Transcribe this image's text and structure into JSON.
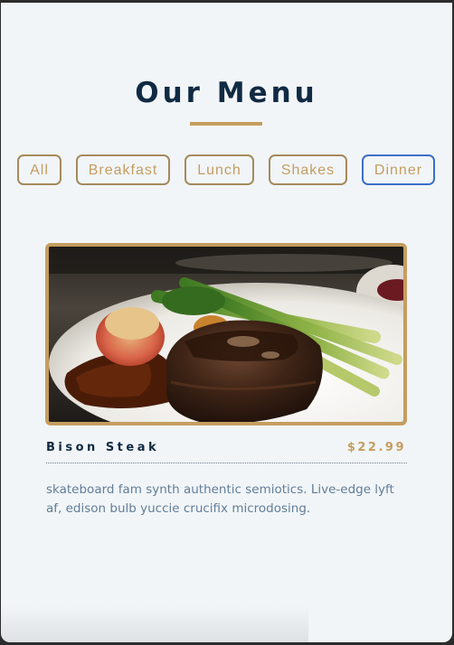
{
  "header": {
    "title": "Our Menu"
  },
  "filters": [
    {
      "label": "All",
      "active": false
    },
    {
      "label": "Breakfast",
      "active": false
    },
    {
      "label": "Lunch",
      "active": false
    },
    {
      "label": "Shakes",
      "active": false
    },
    {
      "label": "Dinner",
      "active": true
    }
  ],
  "menu": {
    "items": [
      {
        "name": "Bison Steak",
        "price": "$22.99",
        "description": "skateboard fam synth authentic semiotics. Live-edge lyft af, edison bulb yuccie crucifix microdosing.",
        "image_icon": "steak-plate-photo"
      }
    ]
  },
  "colors": {
    "accent": "#c59d5f",
    "heading": "#102a43",
    "body_text": "#627d98",
    "background": "#f1f5f8",
    "focus_outline": "#3b6fc9"
  }
}
